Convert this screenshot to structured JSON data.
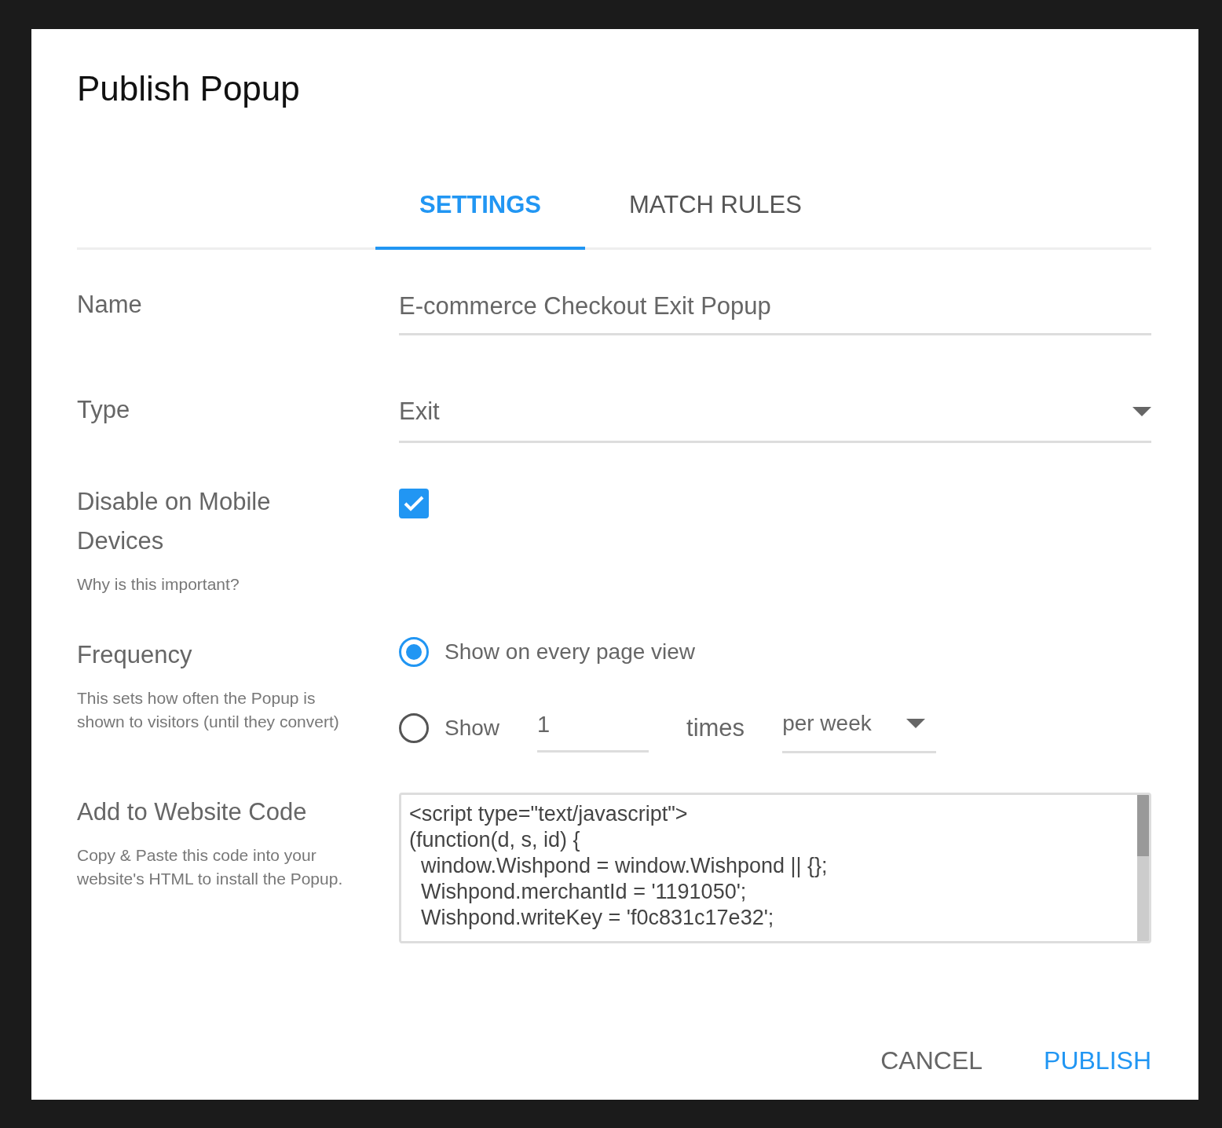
{
  "dialog": {
    "title": "Publish Popup"
  },
  "tabs": [
    {
      "label": "SETTINGS",
      "selected": true
    },
    {
      "label": "MATCH RULES",
      "selected": false
    }
  ],
  "name_field": {
    "label": "Name",
    "value": "E-commerce Checkout Exit Popup"
  },
  "type_field": {
    "label": "Type",
    "value": "Exit"
  },
  "mobile": {
    "label": "Disable on Mobile Devices",
    "help_link": "Why is this important?",
    "checked": true
  },
  "frequency": {
    "label": "Frequency",
    "help": "This sets how often the Popup is shown to visitors (until they convert)",
    "options": [
      {
        "kind": "simple",
        "label": "Show on every page view",
        "selected": true
      },
      {
        "kind": "count",
        "label": "Show",
        "count": "1",
        "unit": "times",
        "period": "per week",
        "selected": false
      }
    ]
  },
  "code": {
    "label": "Add to Website Code",
    "help": "Copy & Paste this code into your website's HTML to install the Popup.",
    "lines": [
      "<script type=\"text/javascript\">",
      "(function(d, s, id) {",
      "  window.Wishpond = window.Wishpond || {};",
      "  Wishpond.merchantId = '1191050';",
      "  Wishpond.writeKey = 'f0c831c17e32';"
    ]
  },
  "buttons": [
    {
      "kind": "secondary",
      "label": "CANCEL"
    },
    {
      "kind": "primary",
      "label": "PUBLISH"
    }
  ]
}
